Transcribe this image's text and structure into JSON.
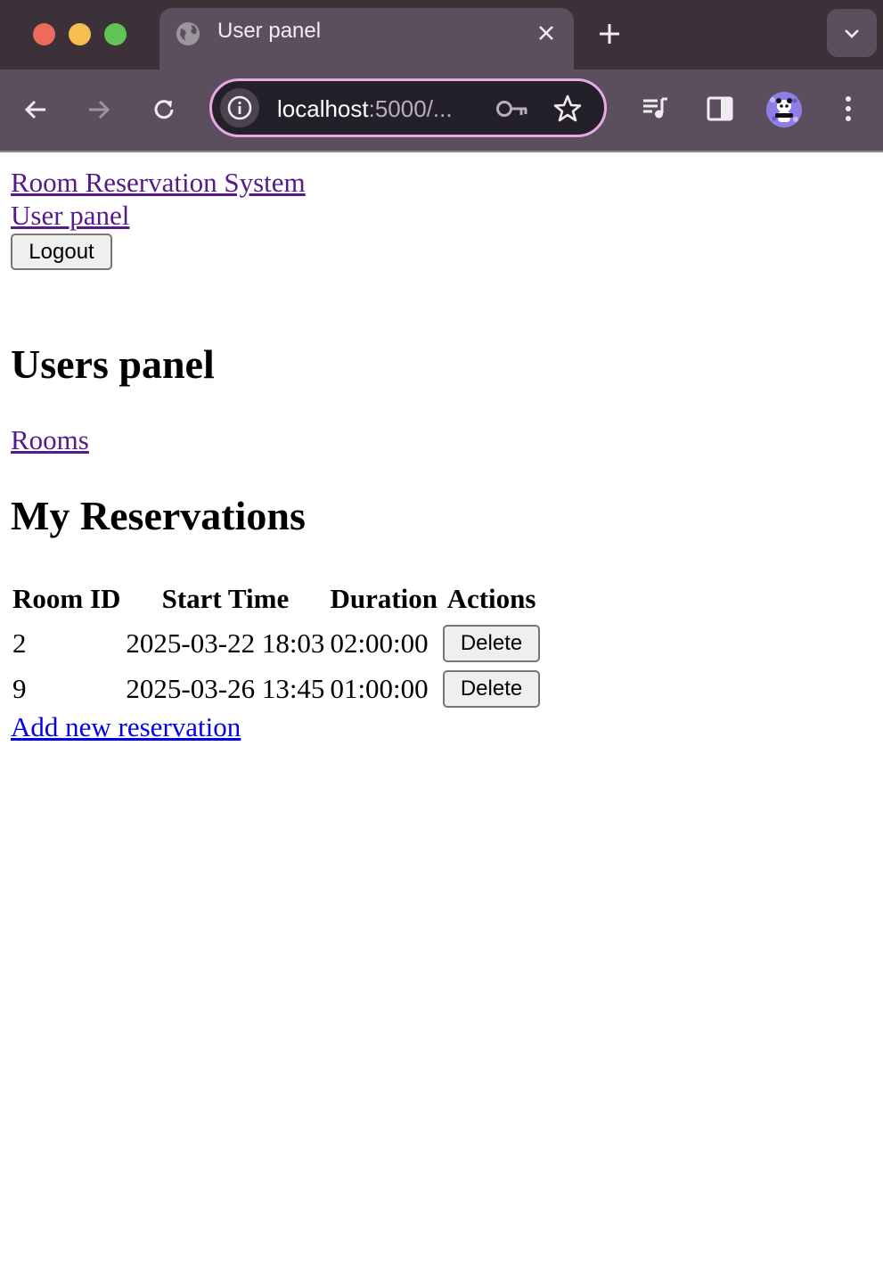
{
  "browser": {
    "tab_title": "User panel",
    "url_host": "localhost",
    "url_rest": ":5000/..."
  },
  "nav": {
    "home_link": "Room Reservation System",
    "user_link": "User panel",
    "logout_label": "Logout"
  },
  "main": {
    "heading": "Users panel",
    "rooms_link": "Rooms",
    "reservations_heading": "My Reservations",
    "table": {
      "headers": [
        "Room ID",
        "Start Time",
        "Duration",
        "Actions"
      ],
      "rows": [
        {
          "room_id": "2",
          "start_time": "2025-03-22 18:03",
          "duration": "02:00:00",
          "action": "Delete"
        },
        {
          "room_id": "9",
          "start_time": "2025-03-26 13:45",
          "duration": "01:00:00",
          "action": "Delete"
        }
      ]
    },
    "add_link": "Add new reservation"
  },
  "colors": {
    "visited_link": "#551a8b",
    "link": "#0000ee",
    "chrome_bg": "#5c4f5d",
    "tabstrip_bg": "#3c3039",
    "omnibox_ring": "#e7a8e4"
  }
}
